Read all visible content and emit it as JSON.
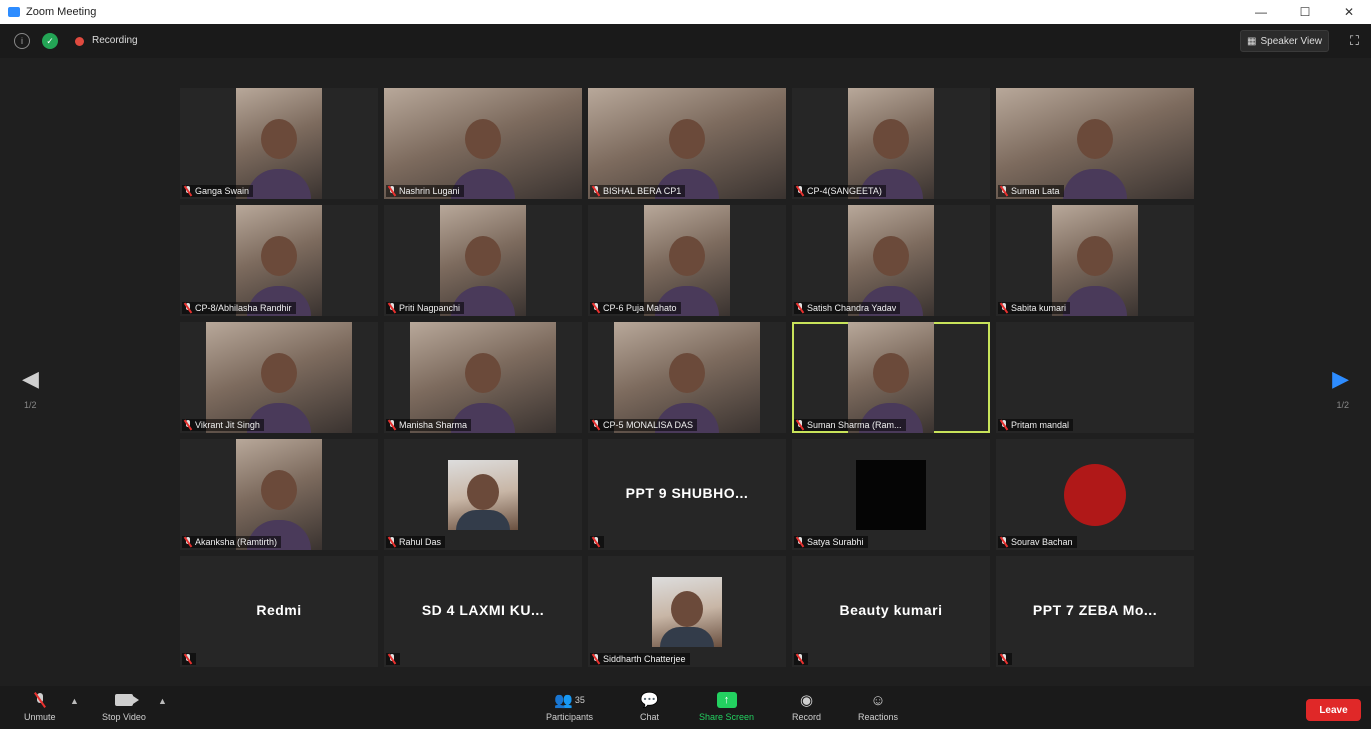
{
  "window": {
    "title": "Zoom Meeting",
    "controls": [
      "—",
      "☐",
      "✕"
    ]
  },
  "topbar": {
    "recording_label": "Recording",
    "speaker_view_label": "Speaker View"
  },
  "navigation": {
    "page_indicator_left": "1/2",
    "page_indicator_right": "1/2"
  },
  "participants": [
    {
      "name": "Ganga Swain",
      "type": "video"
    },
    {
      "name": "Nashrin Lugani",
      "type": "video"
    },
    {
      "name": "BISHAL BERA CP1",
      "type": "video"
    },
    {
      "name": "CP-4(SANGEETA)",
      "type": "video"
    },
    {
      "name": "Suman Lata",
      "type": "video"
    },
    {
      "name": "CP-8/Abhilasha Randhir",
      "type": "video"
    },
    {
      "name": "Priti Nagpanchi",
      "type": "video"
    },
    {
      "name": "CP-6 Puja Mahato",
      "type": "video"
    },
    {
      "name": "Satish Chandra Yadav",
      "type": "video"
    },
    {
      "name": "Sabita kumari",
      "type": "video"
    },
    {
      "name": "Vikrant Jit Singh",
      "type": "video"
    },
    {
      "name": "Manisha Sharma",
      "type": "video"
    },
    {
      "name": "CP-5 MONALISA DAS",
      "type": "video"
    },
    {
      "name": "Suman Sharma (Ram...",
      "type": "video",
      "active": true
    },
    {
      "name": "Pritam mandal",
      "type": "name-only"
    },
    {
      "name": "Akanksha (Ramtirth)",
      "type": "video"
    },
    {
      "name": "Rahul Das",
      "type": "photo"
    },
    {
      "name": "",
      "big_name": "PPT 9 SHUBHO...",
      "type": "big-name"
    },
    {
      "name": "Satya Surabhi",
      "type": "black"
    },
    {
      "name": "Sourav Bachan",
      "type": "logo"
    },
    {
      "name": "",
      "big_name": "Redmi",
      "type": "big-name"
    },
    {
      "name": "",
      "big_name": "SD 4 LAXMI KU...",
      "type": "big-name"
    },
    {
      "name": "Siddharth Chatterjee",
      "type": "photo"
    },
    {
      "name": "",
      "big_name": "Beauty kumari",
      "type": "big-name"
    },
    {
      "name": "",
      "big_name": "PPT 7 ZEBA Mo...",
      "type": "big-name"
    }
  ],
  "toolbar": {
    "unmute_label": "Unmute",
    "stop_video_label": "Stop Video",
    "participants_label": "Participants",
    "participants_count": "35",
    "chat_label": "Chat",
    "share_screen_label": "Share Screen",
    "record_label": "Record",
    "reactions_label": "Reactions",
    "leave_label": "Leave"
  },
  "colors": {
    "accent_blue": "#2d8cff",
    "share_green": "#23d160",
    "leave_red": "#e02828",
    "active_speaker": "#c8e35a",
    "muted_red": "#e8312f"
  }
}
